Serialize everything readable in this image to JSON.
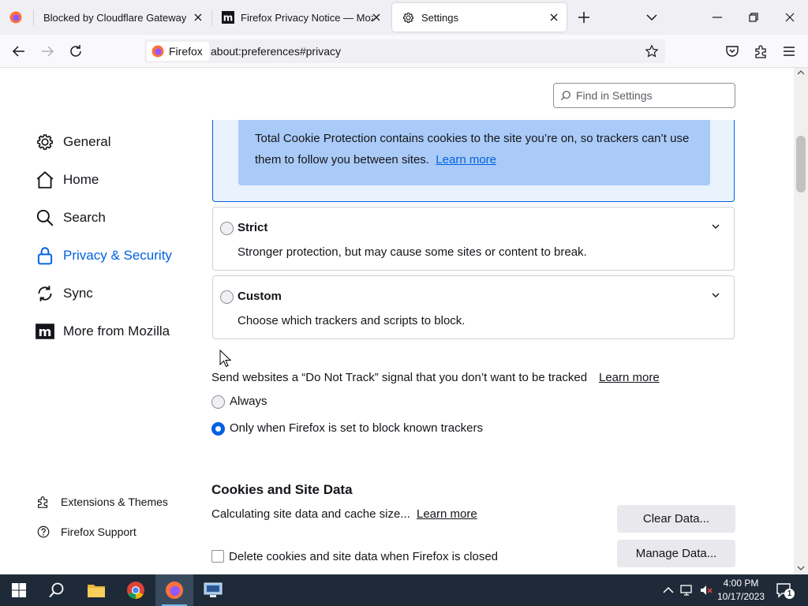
{
  "window": {
    "controls": {
      "minimize": "minimize-icon",
      "restore": "restore-icon",
      "close": "close-icon"
    }
  },
  "tabs": [
    {
      "title": "Blocked by Cloudflare Gateway",
      "icon": "firefox-icon",
      "selected": false
    },
    {
      "title": "Firefox Privacy Notice — Mozill",
      "icon": "mozilla-m-icon",
      "selected": false
    },
    {
      "title": "Settings",
      "icon": "gear-icon",
      "selected": true
    }
  ],
  "navbar": {
    "identity_label": "Firefox",
    "url": "about:preferences#privacy"
  },
  "settings": {
    "find_placeholder": "Find in Settings",
    "categories": [
      {
        "label": "General",
        "icon": "gear-icon"
      },
      {
        "label": "Home",
        "icon": "home-icon"
      },
      {
        "label": "Search",
        "icon": "search-icon"
      },
      {
        "label": "Privacy & Security",
        "icon": "lock-icon",
        "selected": true
      },
      {
        "label": "Sync",
        "icon": "sync-icon"
      },
      {
        "label": "More from Mozilla",
        "icon": "mozilla-m-icon"
      }
    ],
    "footer": [
      {
        "label": "Extensions & Themes",
        "icon": "puzzle-icon"
      },
      {
        "label": "Firefox Support",
        "icon": "help-icon"
      }
    ],
    "tcp_info": {
      "text": "Total Cookie Protection contains cookies to the site you’re on, so trackers can’t use them to follow you between sites.",
      "link": "Learn more"
    },
    "strict": {
      "title": "Strict",
      "description": "Stronger protection, but may cause some sites or content to break."
    },
    "custom": {
      "title": "Custom",
      "description": "Choose which trackers and scripts to block."
    },
    "dnt": {
      "label": "Send websites a “Do Not Track” signal that you don’t want to be tracked",
      "link": "Learn more",
      "options": [
        {
          "label": "Always",
          "checked": false
        },
        {
          "label": "Only when Firefox is set to block known trackers",
          "checked": true
        }
      ]
    },
    "cookies": {
      "heading": "Cookies and Site Data",
      "status": "Calculating site data and cache size...",
      "link": "Learn more",
      "clear_button": "Clear Data...",
      "manage_button": "Manage Data...",
      "delete_checkbox": "Delete cookies and site data when Firefox is closed"
    }
  },
  "taskbar": {
    "time": "4:00 PM",
    "date": "10/17/2023",
    "notification_count": "1"
  },
  "colors": {
    "accent": "#0061e0",
    "info_background": "#aacbf7",
    "taskbar": "#1f2a38"
  }
}
